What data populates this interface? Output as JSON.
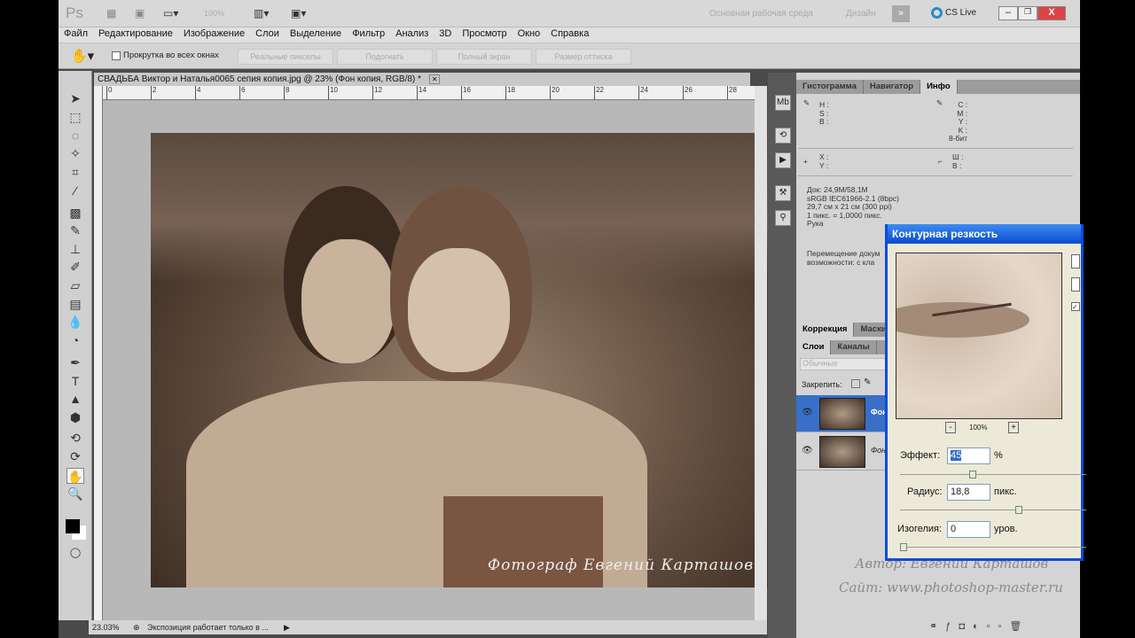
{
  "app": {
    "logo": "Ps",
    "zoom_select": "100%",
    "workspace": "Основная рабочая среда",
    "design": "Дизайн",
    "cs_live": "CS Live"
  },
  "menu": [
    "Файл",
    "Редактирование",
    "Изображение",
    "Слои",
    "Выделение",
    "Фильтр",
    "Анализ",
    "3D",
    "Просмотр",
    "Окно",
    "Справка"
  ],
  "options": {
    "scroll_all": "Прокрутка во всех окнах",
    "scroll_all_checked": false,
    "buttons": [
      "Реальные пикселы",
      "Подогнать",
      "Полный экран",
      "Размер оттиска"
    ]
  },
  "document": {
    "tab_title": "СВАДЬБА Виктор и Наталья0065 сепия копия.jpg @ 23% (Фон копия, RGB/8) *",
    "ruler_labels": [
      "0",
      "2",
      "4",
      "6",
      "8",
      "10",
      "12",
      "14",
      "16",
      "18",
      "20",
      "22",
      "24",
      "26",
      "28"
    ],
    "watermark": "Фотограф Евгений Карташов"
  },
  "status": {
    "zoom": "23.03%",
    "message": "Экспозиция работает только в ..."
  },
  "panels": {
    "top_tabs": [
      "Гистограмма",
      "Навигатор",
      "Инфо"
    ],
    "info": {
      "hsb": [
        "H :",
        "S :",
        "B :"
      ],
      "cmyk": [
        "C :",
        "M :",
        "Y :",
        "K :",
        "8-бит"
      ],
      "xy": [
        "X :",
        "Y :"
      ],
      "wh": [
        "Ш :",
        "В :"
      ],
      "doc_lines": [
        "Док: 24,9M/58,1M",
        "sRGB IEC61966-2.1 (8bpc)",
        "29,7 см x 21 см (300 ppi)",
        "1 пикс. = 1,0000 пикс.",
        "Рука"
      ],
      "hint_lines": [
        "Перемещение докум",
        "возможности: с кла"
      ]
    },
    "mid_tabs": [
      "Коррекция",
      "Маски"
    ],
    "layer_tabs": [
      "Слои",
      "Каналы"
    ],
    "blend_mode": "Обычные",
    "lock_label": "Закрепить:",
    "layers": [
      {
        "name": "Фон копия",
        "selected": true,
        "visible": true
      },
      {
        "name": "Фон",
        "selected": false,
        "visible": true
      }
    ]
  },
  "dialog": {
    "title": "Контурная резкость",
    "zoom": "100%",
    "zoom_out": "-",
    "zoom_in": "+",
    "amount_label": "Эффект:",
    "amount": "45",
    "amount_unit": "%",
    "amount_pct": 0.09,
    "radius_label": "Радиус:",
    "radius": "18,8",
    "radius_unit": "пикс.",
    "radius_pct": 0.5,
    "threshold_label": "Изогелия:",
    "threshold": "0",
    "threshold_unit": "уров.",
    "threshold_pct": 0
  },
  "credits": {
    "author": "Автор: Евгений Карташов",
    "site": "Сайт: www.photoshop-master.ru"
  },
  "colors": {
    "dialog_title": "#0a4bd0",
    "selected_layer": "#3a6fc8",
    "foreground": "#000000",
    "background": "#ffffff"
  }
}
